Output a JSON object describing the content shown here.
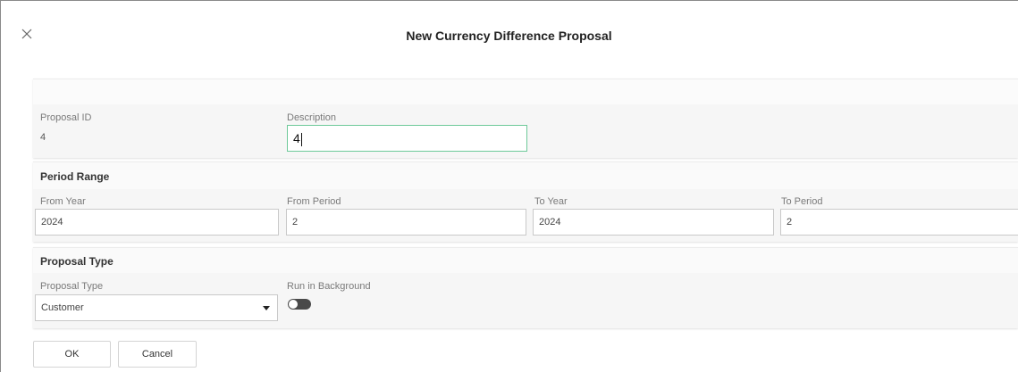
{
  "dialog": {
    "title": "New Currency Difference Proposal",
    "close_icon": "close-icon"
  },
  "general": {
    "proposal_id_label": "Proposal ID",
    "proposal_id_value": "4",
    "description_label": "Description",
    "description_value": "4"
  },
  "period_range": {
    "title": "Period Range",
    "from_year_label": "From Year",
    "from_year_value": "2024",
    "from_period_label": "From Period",
    "from_period_value": "2",
    "to_year_label": "To Year",
    "to_year_value": "2024",
    "to_period_label": "To Period",
    "to_period_value": "2"
  },
  "proposal_type": {
    "title": "Proposal Type",
    "type_label": "Proposal Type",
    "type_value": "Customer",
    "run_background_label": "Run in Background",
    "run_background_on": false
  },
  "actions": {
    "ok_label": "OK",
    "cancel_label": "Cancel"
  },
  "colors": {
    "active_border": "#6ec99a",
    "toggle_off": "#4a4a4a"
  }
}
